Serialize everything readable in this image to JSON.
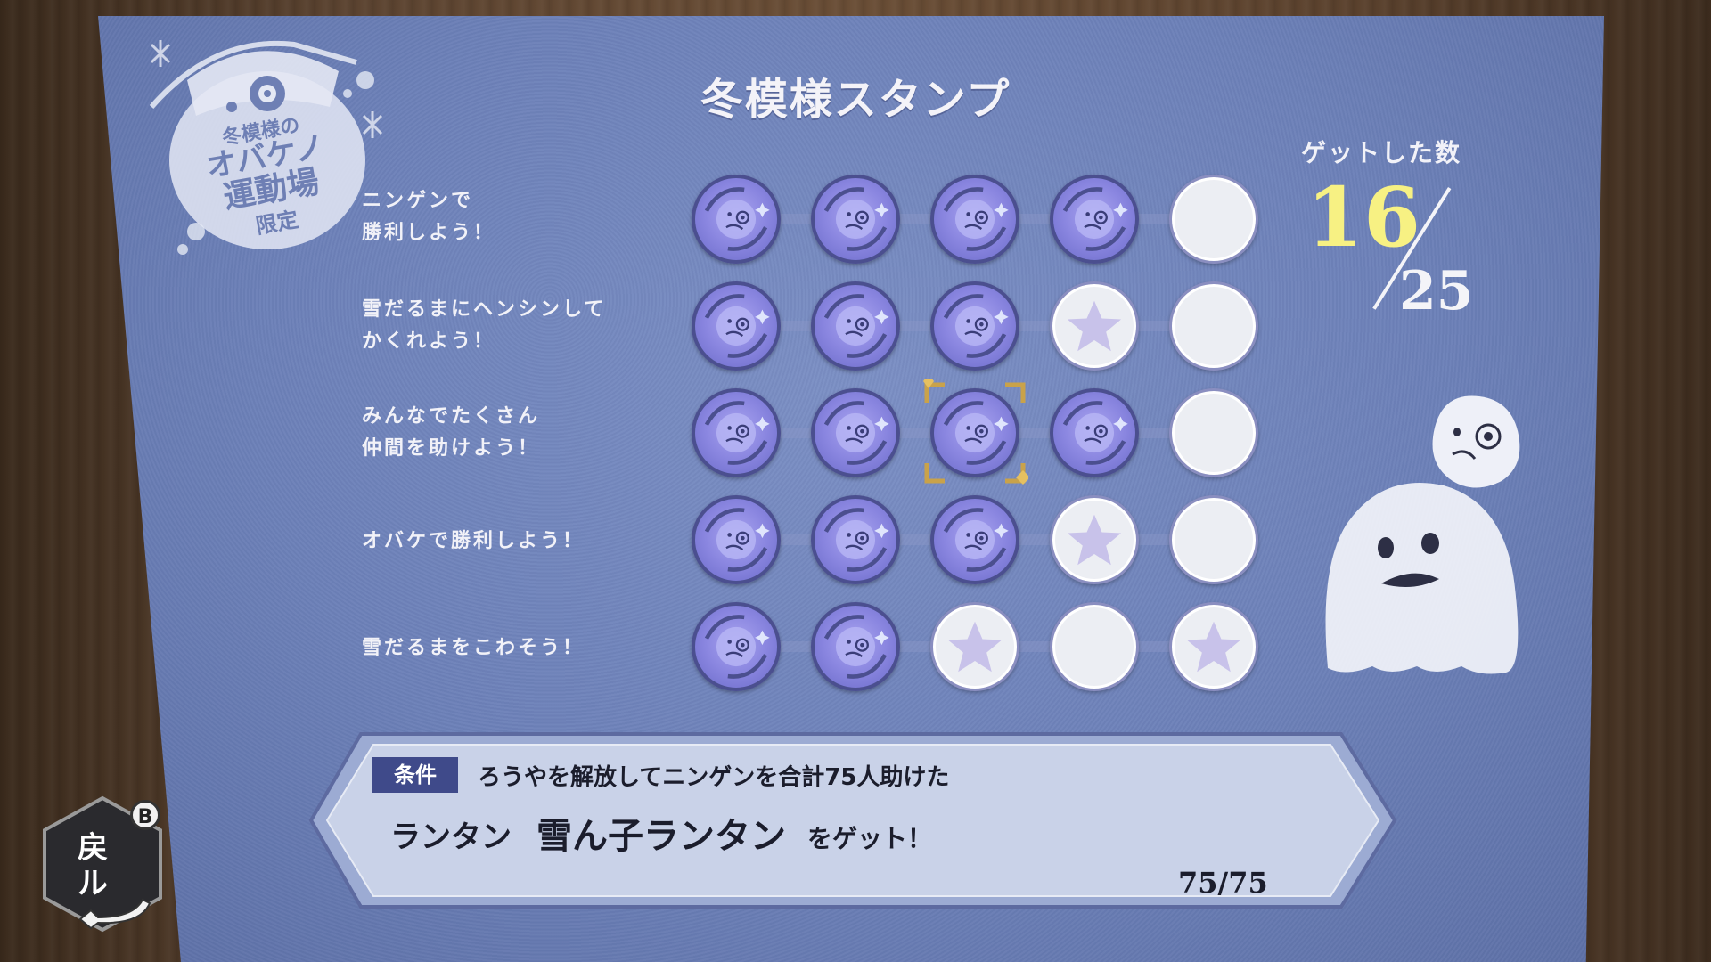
{
  "title": "冬模様スタンプ",
  "logo": {
    "line1": "冬模様の",
    "line2": "オバケノ",
    "line3": "運動場",
    "line4": "限定"
  },
  "rows": [
    {
      "label": "ニンゲンで\n勝利しよう！"
    },
    {
      "label": "雪だるまにヘンシンして\nかくれよう！"
    },
    {
      "label": "みんなでたくさん\n仲間を助けよう！"
    },
    {
      "label": "オバケで勝利しよう！"
    },
    {
      "label": "雪だるまをこわそう！"
    }
  ],
  "grid": [
    [
      "earned",
      "earned",
      "earned",
      "earned",
      "empty"
    ],
    [
      "earned",
      "earned",
      "earned",
      "star",
      "empty"
    ],
    [
      "earned",
      "earned",
      "earned",
      "earned",
      "empty"
    ],
    [
      "earned",
      "earned",
      "earned",
      "star",
      "empty"
    ],
    [
      "earned",
      "earned",
      "star",
      "empty",
      "star"
    ]
  ],
  "selected": {
    "row": 2,
    "col": 2
  },
  "count": {
    "label": "ゲットした数",
    "got": "16",
    "total": "25"
  },
  "condition": {
    "tag": "条件",
    "text": "ろうやを解放してニンゲンを合計75人助けた",
    "reward_part1": "ランタン",
    "reward_part2": "雪ん子ランタン",
    "reward_suffix": "をゲット！",
    "progress": "75/75"
  },
  "back_button": {
    "label": "戻\nル",
    "key": "B"
  },
  "colors": {
    "accent_yellow": "#f7f183",
    "tag_bg": "#3f4a8a",
    "board": "#6c80b8",
    "stamp_earned": "#8a86e0"
  }
}
